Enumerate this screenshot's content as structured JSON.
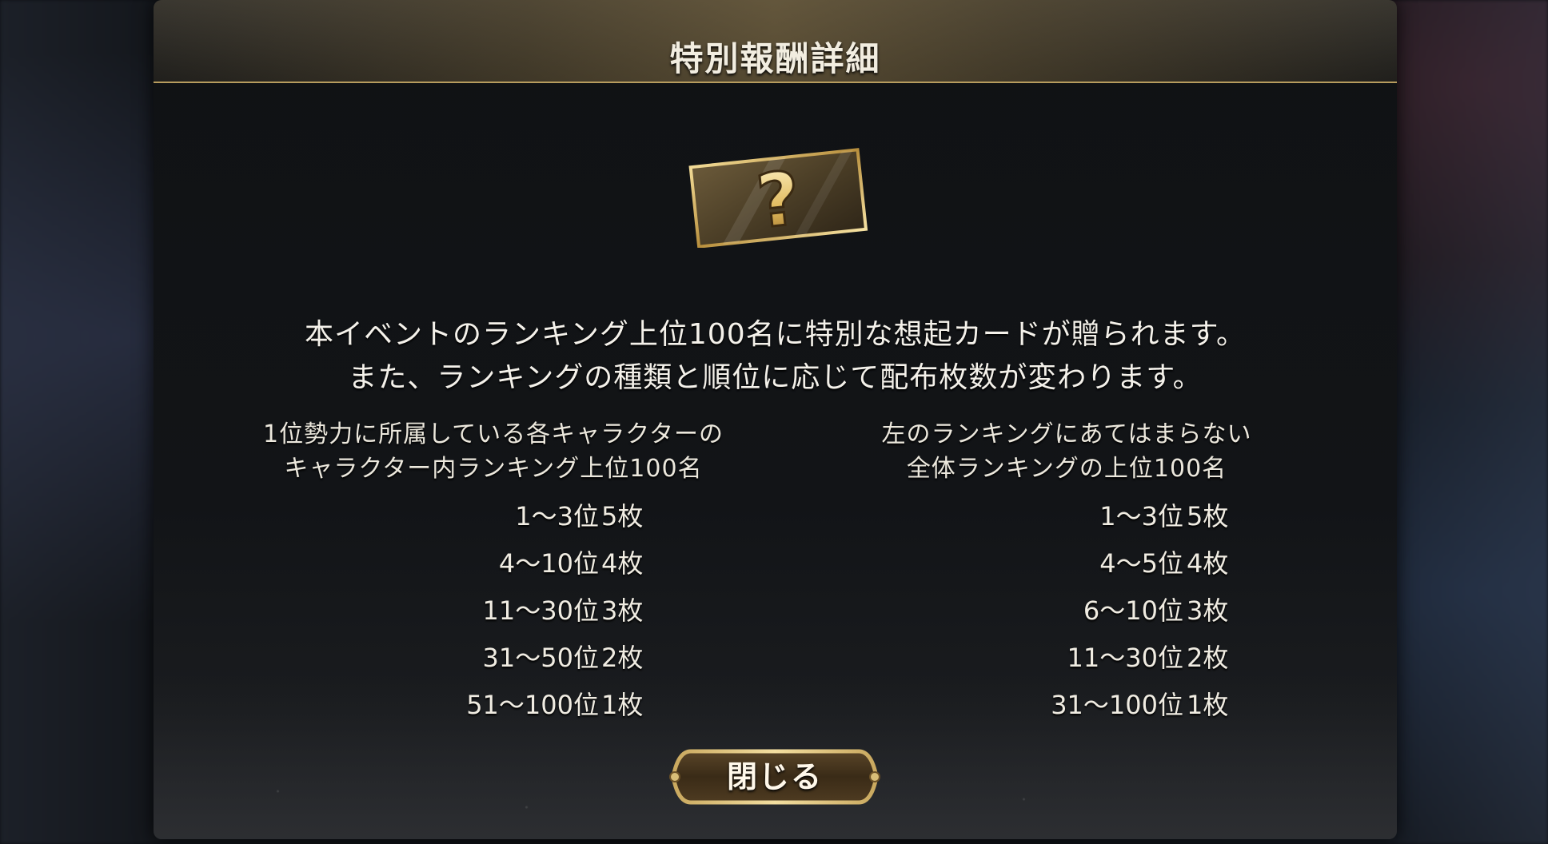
{
  "dialog": {
    "title": "特別報酬詳細",
    "icon": "mystery-card-icon",
    "description_lines": [
      "本イベントのランキング上位100名に特別な想起カードが贈られます。",
      "また、ランキングの種類と順位に応じて配布枚数が変わります。"
    ],
    "left_table": {
      "header_lines": [
        "1位勢力に所属している各キャラクターの",
        "キャラクター内ランキング上位100名"
      ],
      "rows": [
        {
          "range": "1～3位",
          "count": "5枚"
        },
        {
          "range": "4～10位",
          "count": "4枚"
        },
        {
          "range": "11～30位",
          "count": "3枚"
        },
        {
          "range": "31～50位",
          "count": "2枚"
        },
        {
          "range": "51～100位",
          "count": "1枚"
        }
      ]
    },
    "right_table": {
      "header_lines": [
        "左のランキングにあてはまらない",
        "全体ランキングの上位100名"
      ],
      "rows": [
        {
          "range": "1～3位",
          "count": "5枚"
        },
        {
          "range": "4～5位",
          "count": "4枚"
        },
        {
          "range": "6～10位",
          "count": "3枚"
        },
        {
          "range": "11～30位",
          "count": "2枚"
        },
        {
          "range": "31～100位",
          "count": "1枚"
        }
      ]
    },
    "close_label": "閉じる",
    "colors": {
      "accent_gold": "#c9a85e",
      "panel_bg": "#111316",
      "text": "#f2ede0"
    }
  }
}
